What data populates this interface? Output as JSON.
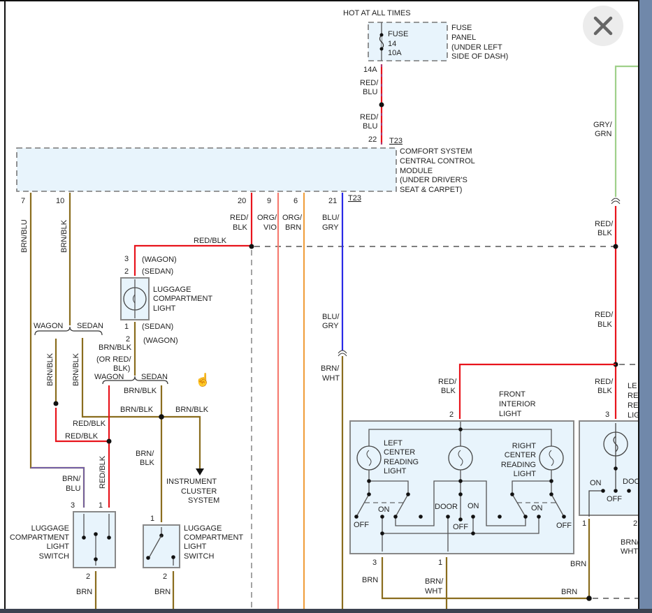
{
  "overlay": {
    "close_icon": "close-x-icon"
  },
  "colors": {
    "brn": "#8a6d1e",
    "red": "#e8141c",
    "org": "#f0a040",
    "blu": "#2a2ae6",
    "grn": "#9fd08a",
    "component_fill": "#e8f4fc"
  },
  "top": {
    "hot": "HOT AT ALL TIMES",
    "fuse": [
      "FUSE",
      "14",
      "10A"
    ],
    "fuse_panel": [
      "FUSE",
      "PANEL",
      "(UNDER LEFT",
      "SIDE OF DASH)"
    ],
    "pin_14a": "14A",
    "wire_red_blu": [
      "RED/",
      "BLU"
    ],
    "pin_22": "22",
    "t23": "T23"
  },
  "module": {
    "label": [
      "COMFORT SYSTEM",
      "CENTRAL CONTROL",
      "MODULE",
      "(UNDER DRIVER'S",
      "SEAT & CARPET)"
    ],
    "pins": [
      "7",
      "10",
      "20",
      "9",
      "6",
      "21"
    ],
    "t23": "T23"
  },
  "wires": {
    "brn_blu": "BRN/BLU",
    "brn_blk": "BRN/BLK",
    "red_blk": "RED/BLK",
    "red": "RED/",
    "blk": "BLK",
    "org": "ORG/",
    "vio": "VIO",
    "brn_word": "BRN",
    "blu": "BLU/",
    "gry": "GRY",
    "brn_slash": "BRN/",
    "wht": "WHT",
    "gry_slash": "GRY/",
    "grn": "GRN",
    "blu_word": "BLU",
    "or_red": "(OR RED/",
    "blk_paren": "BLK)"
  },
  "variants": {
    "wagon": "WAGON",
    "sedan": "SEDAN",
    "wagon_p": "(WAGON)",
    "sedan_p": "(SEDAN)"
  },
  "luggage_light": {
    "label": [
      "LUGGAGE",
      "COMPARTMENT",
      "LIGHT"
    ],
    "pins": [
      "3",
      "2",
      "1",
      "2"
    ]
  },
  "luggage_switch": {
    "label": [
      "LUGGAGE",
      "COMPARTMENT",
      "LIGHT",
      "SWITCH"
    ],
    "pins": [
      "3",
      "1",
      "2",
      "1",
      "2"
    ]
  },
  "instrument": [
    "INSTRUMENT",
    "CLUSTER",
    "SYSTEM"
  ],
  "front_interior": {
    "label": [
      "FRONT",
      "INTERIOR",
      "LIGHT"
    ],
    "left": [
      "LEFT",
      "CENTER",
      "READING",
      "LIGHT"
    ],
    "right": [
      "RIGHT",
      "CENTER",
      "READING",
      "LIGHT"
    ],
    "off": "OFF",
    "on": "ON",
    "door": "DOOR",
    "pins": [
      "2",
      "3",
      "1"
    ]
  },
  "rear_light": {
    "label": [
      "LE",
      "RE",
      "RE",
      "LIG"
    ],
    "pins": [
      "3",
      "1",
      "2"
    ],
    "on": "ON",
    "door": "DOO",
    "off": "OFF"
  }
}
